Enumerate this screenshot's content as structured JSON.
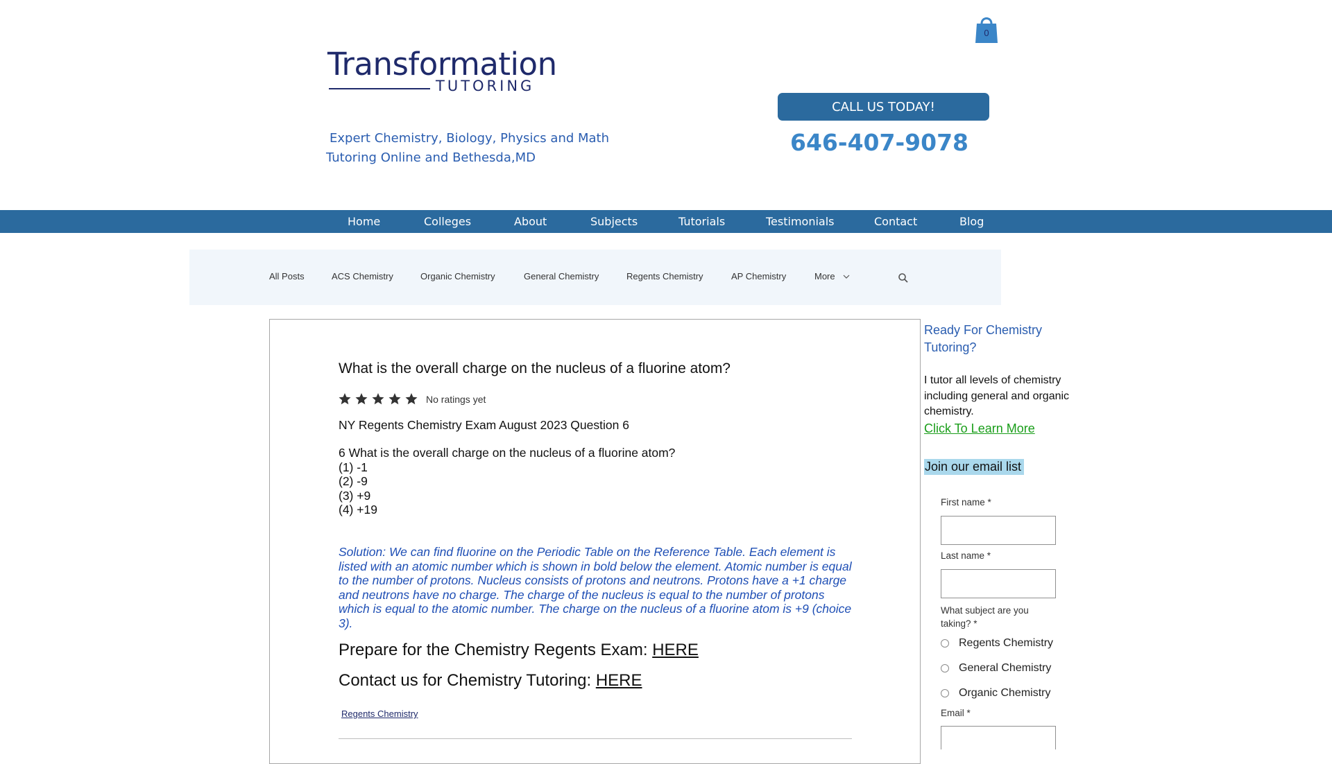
{
  "header": {
    "logo_main": "Transformation",
    "logo_sub": "TUTORING",
    "tagline_line1": "Expert Chemistry, Biology, Physics and Math",
    "tagline_line2": "Tutoring Online and Bethesda,MD",
    "cart_count": "0",
    "call_button": "CALL US TODAY!",
    "phone": "646-407-9078"
  },
  "nav": [
    "Home",
    "Colleges",
    "About",
    "Subjects",
    "Tutorials",
    "Testimonials",
    "Contact",
    "Blog"
  ],
  "categories": [
    "All Posts",
    "ACS Chemistry",
    "Organic Chemistry",
    "General Chemistry",
    "Regents Chemistry",
    "AP Chemistry",
    "More"
  ],
  "post": {
    "title": "What is the overall charge on the nucleus of a fluorine atom?",
    "rating_text": "No ratings yet",
    "exam_line": "NY Regents Chemistry Exam August 2023 Question 6",
    "question": "6 What is the overall charge on the nucleus of a fluorine atom?",
    "choices": [
      "(1) -1",
      "(2) -9",
      "(3) +9",
      "(4) +19"
    ],
    "solution": "Solution: We can find fluorine on the Periodic Table on the Reference Table. Each element is listed with an atomic number which is shown in bold below the element. Atomic number is equal to the number of protons. Nucleus consists of protons and neutrons. Protons have a +1 charge and neutrons have no charge. The charge of the nucleus is equal to the number of protons which is equal to the atomic number. The charge on the nucleus of a fluorine atom is +9 (choice 3).",
    "prepare_text": "Prepare for the Chemistry Regents Exam: ",
    "prepare_link": "HERE",
    "contact_text": "Contact us for Chemistry Tutoring: ",
    "contact_link": "HERE",
    "tag": "Regents Chemistry"
  },
  "sidebar": {
    "heading_line1": "Ready For Chemistry",
    "heading_line2": "Tutoring?",
    "desc_line1": "I tutor all levels of chemistry",
    "desc_line2": "including general and organic",
    "desc_line3": "chemistry.",
    "learn_more": "Click To Learn More",
    "email_heading": "Join our email list",
    "first_name_label": "First name *",
    "last_name_label": "Last name *",
    "subject_label_line1": "What subject are you",
    "subject_label_line2": "taking? *",
    "subject_options": [
      "Regents Chemistry",
      "General Chemistry",
      "Organic Chemistry"
    ],
    "email_label": "Email *"
  },
  "colors": {
    "brand_blue": "#2b6a9e",
    "accent_blue": "#3b86c8",
    "link_green": "#1a9e1a",
    "navy": "#1f2a6b"
  }
}
